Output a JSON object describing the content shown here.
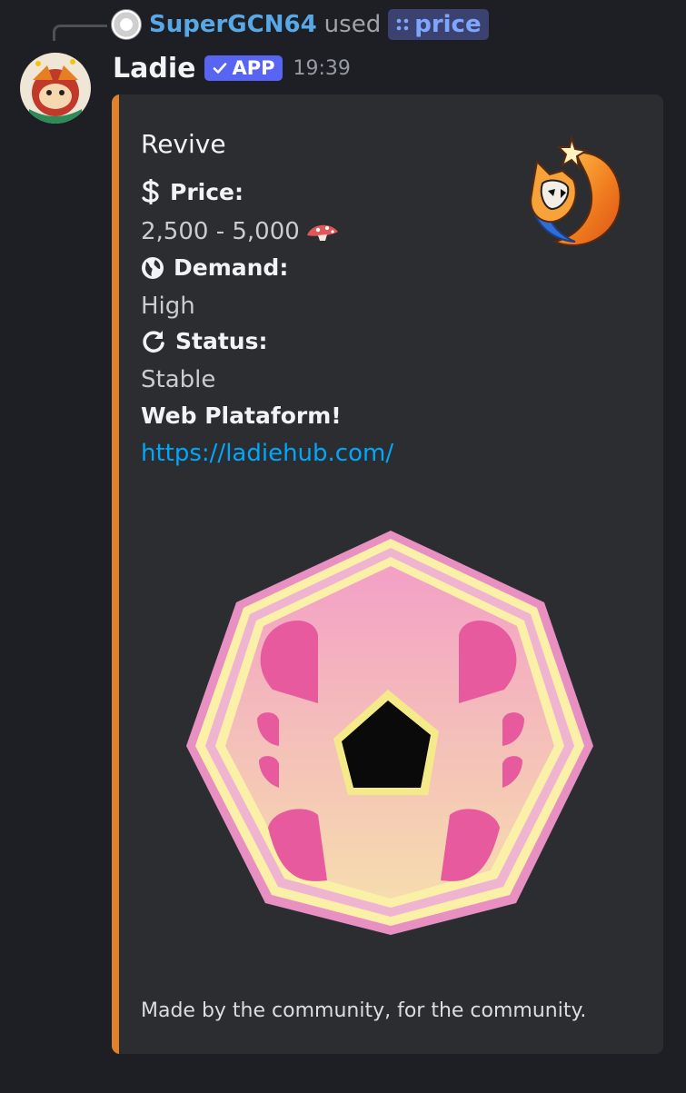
{
  "reply": {
    "user": "SuperGCN64",
    "action": "used",
    "command": "price",
    "command_icon": "slash-command-icon"
  },
  "message": {
    "author": "Ladie",
    "badge": "APP",
    "badge_icon": "checkmark-icon",
    "timestamp": "19:39"
  },
  "embed": {
    "accent_color": "#e0812b",
    "title": "Revive",
    "fields": [
      {
        "icon": "dollar-icon",
        "name": "Price:",
        "value": "2,500 - 5,000",
        "value_icon": "mushroom-icon"
      },
      {
        "icon": "globe-icon",
        "name": "Demand:",
        "value": "High"
      },
      {
        "icon": "refresh-icon",
        "name": "Status:",
        "value": "Stable"
      }
    ],
    "promo_heading": "Web Plataform!",
    "link": "https://ladiehub.com/",
    "footer": "Made by the community, for the community."
  }
}
